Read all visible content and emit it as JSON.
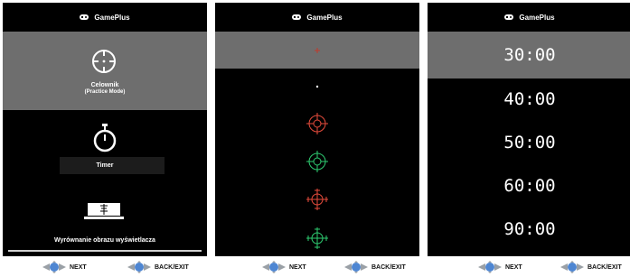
{
  "header": {
    "title": "GamePlus",
    "icon": "gamepad-icon"
  },
  "panel1": {
    "items": [
      {
        "title": "Celownik",
        "subtitle": "(Practice Mode)",
        "icon": "crosshair-icon",
        "selected": true
      },
      {
        "title": "Timer",
        "icon": "stopwatch-icon",
        "selected": false
      },
      {
        "title": "Wyrównanie obrazu wyświetlacza",
        "icon": "display-alignment-icon",
        "selected": false
      }
    ]
  },
  "panel2": {
    "items": [
      {
        "icon": "crosshair-tiny-red-icon",
        "color": "#c0392b",
        "selected": true
      },
      {
        "icon": "dot-icon",
        "color": "#ffffff",
        "selected": false
      },
      {
        "icon": "crosshair-circle-red-icon",
        "color": "#e74c3c",
        "selected": false
      },
      {
        "icon": "crosshair-circle-green-icon",
        "color": "#2ecc71",
        "selected": false
      },
      {
        "icon": "crosshair-cross-red-icon",
        "color": "#e74c3c",
        "selected": false
      },
      {
        "icon": "crosshair-cross-green-icon",
        "color": "#2ecc71",
        "selected": false
      }
    ]
  },
  "panel3": {
    "times": [
      "30:00",
      "40:00",
      "50:00",
      "60:00",
      "90:00"
    ],
    "selected_index": 0
  },
  "footer": {
    "next_label": "NEXT",
    "back_label": "BACK/EXIT"
  }
}
